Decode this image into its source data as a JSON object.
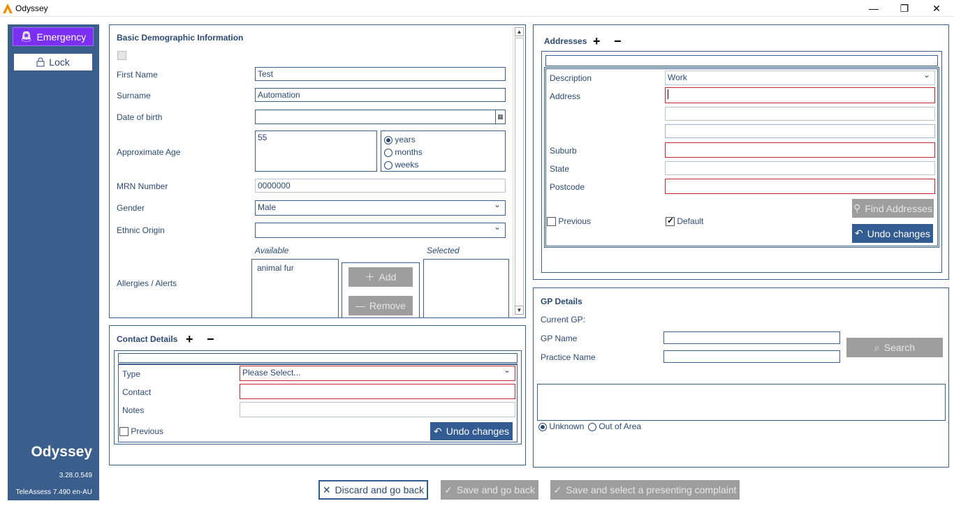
{
  "window": {
    "title": "Odyssey"
  },
  "sidebar": {
    "emergency_label": "Emergency",
    "lock_label": "Lock",
    "brand": "Odyssey",
    "version": "3.28.0.549",
    "teleassess": "TeleAssess 7.490 en-AU"
  },
  "demographics": {
    "header": "Basic Demographic Information",
    "first_name_label": "First Name",
    "first_name": "Test",
    "surname_label": "Surname",
    "surname": "Automation",
    "dob_label": "Date of birth",
    "dob": "",
    "age_label": "Approximate Age",
    "age": "55",
    "age_units": [
      "years",
      "months",
      "weeks"
    ],
    "mrn_label": "MRN Number",
    "mrn": "0000000",
    "gender_label": "Gender",
    "gender": "Male",
    "ethnic_label": "Ethnic Origin",
    "ethnic": "",
    "allergies_label": "Allergies / Alerts",
    "available_label": "Available",
    "selected_label": "Selected",
    "available_items": [
      "animal fur"
    ],
    "add_label": "Add",
    "remove_label": "Remove"
  },
  "contact": {
    "header": "Contact Details",
    "type_label": "Type",
    "type_value": "Please Select...",
    "contact_label": "Contact",
    "notes_label": "Notes",
    "previous_label": "Previous",
    "undo_label": "Undo changes"
  },
  "addresses": {
    "header": "Addresses",
    "description_label": "Description",
    "description_value": "Work",
    "address_label": "Address",
    "suburb_label": "Suburb",
    "state_label": "State",
    "postcode_label": "Postcode",
    "find_label": "Find Addresses",
    "previous_label": "Previous",
    "default_label": "Default",
    "undo_label": "Undo changes"
  },
  "gp": {
    "header": "GP Details",
    "current_label": "Current GP:",
    "name_label": "GP Name",
    "practice_label": "Practice Name",
    "search_label": "Search",
    "unknown_label": "Unknown",
    "out_of_area_label": "Out of Area"
  },
  "footer": {
    "discard_label": "Discard and go back",
    "save_label": "Save and go back",
    "save_complaint_label": "Save and select a presenting complaint"
  }
}
